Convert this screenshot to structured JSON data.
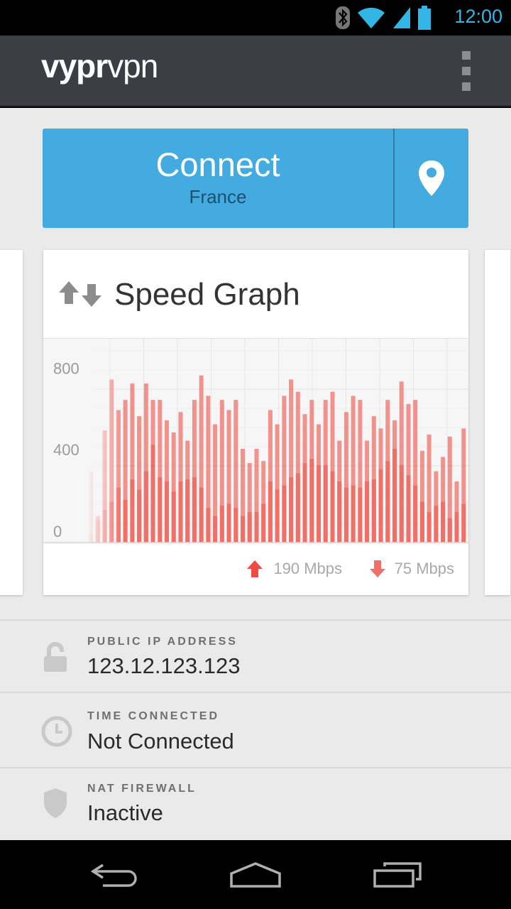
{
  "status_bar": {
    "time": "12:00",
    "icons": [
      "bluetooth-icon",
      "wifi-icon",
      "signal-icon",
      "battery-icon"
    ],
    "accent": "#33b5e5"
  },
  "app_bar": {
    "logo_bold": "vypr",
    "logo_light": "vpn",
    "menu_icon": "overflow-menu-icon"
  },
  "connect": {
    "label": "Connect",
    "country": "France",
    "location_icon": "map-pin-icon",
    "color": "#44abe0"
  },
  "speed_card": {
    "title": "Speed Graph",
    "icon": "up-down-arrows-icon",
    "upload": "190 Mbps",
    "download": "75 Mbps",
    "bar_color": "#f07068"
  },
  "chart_data": {
    "type": "bar",
    "y_ticks": [
      "800",
      "400",
      "0"
    ],
    "ylim": [
      0,
      1000
    ],
    "series": [
      {
        "values": [
          350,
          130,
          550,
          800,
          650,
          700,
          780,
          620,
          780,
          700,
          700,
          600,
          540,
          640,
          500,
          700,
          820,
          720,
          580,
          700,
          650,
          700,
          460,
          390,
          460,
          400,
          650,
          580,
          720,
          800,
          740,
          630,
          700,
          580,
          700,
          740,
          500,
          640,
          720,
          700,
          500,
          620,
          560,
          700,
          600,
          790,
          680,
          700,
          450,
          530,
          350,
          420,
          520,
          300,
          560
        ]
      },
      {
        "values": [
          40,
          110,
          160,
          200,
          270,
          210,
          310,
          260,
          350,
          480,
          320,
          300,
          250,
          300,
          310,
          320,
          270,
          170,
          130,
          180,
          190,
          170,
          130,
          150,
          150,
          190,
          300,
          260,
          280,
          320,
          340,
          390,
          410,
          380,
          380,
          350,
          300,
          270,
          280,
          270,
          300,
          310,
          360,
          400,
          460,
          380,
          330,
          280,
          200,
          150,
          180,
          200,
          120,
          150,
          190
        ]
      }
    ]
  },
  "info_rows": [
    {
      "icon": "lock-icon",
      "label": "PUBLIC IP ADDRESS",
      "value": "123.12.123.123"
    },
    {
      "icon": "clock-icon",
      "label": "TIME CONNECTED",
      "value": "Not Connected"
    },
    {
      "icon": "shield-icon",
      "label": "NAT FIREWALL",
      "value": "Inactive"
    }
  ],
  "nav_bar": {
    "back": "back-icon",
    "home": "home-icon",
    "recents": "recent-apps-icon"
  }
}
